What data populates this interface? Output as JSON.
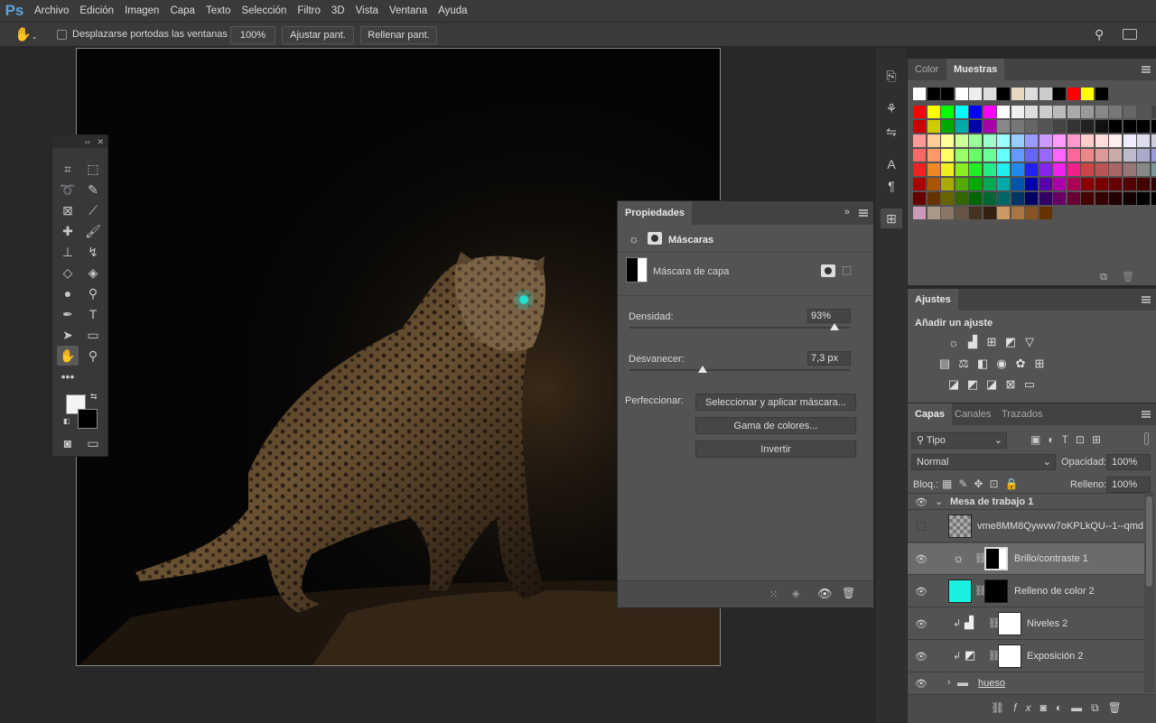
{
  "app": {
    "logo": "Ps"
  },
  "menu": [
    "Archivo",
    "Edición",
    "Imagen",
    "Capa",
    "Texto",
    "Selección",
    "Filtro",
    "3D",
    "Vista",
    "Ventana",
    "Ayuda"
  ],
  "options": {
    "scroll_all_label": "Desplazarse portodas las ventanas",
    "zoom_label": "100%",
    "fit_label": "Ajustar pant.",
    "fill_label": "Rellenar pant."
  },
  "properties": {
    "tab": "Propiedades",
    "section": "Máscaras",
    "mask_label": "Máscara de capa",
    "density_label": "Densidad:",
    "density_value": "93%",
    "density": 0.93,
    "feather_label": "Desvanecer:",
    "feather_value": "7,3 px",
    "feather": 0.33,
    "refine_label": "Perfeccionar:",
    "btn_select_mask": "Seleccionar y aplicar máscara...",
    "btn_color_range": "Gama de colores...",
    "btn_invert": "Invertir"
  },
  "swatches_panel": {
    "tab_color": "Color",
    "tab_swatches": "Muestras"
  },
  "adjustments": {
    "tab": "Ajustes",
    "heading": "Añadir un ajuste"
  },
  "layers_panel": {
    "tabs": [
      "Capas",
      "Canales",
      "Trazados"
    ],
    "filter": "Tipo",
    "blend_mode": "Normal",
    "opacity_label": "Opacidad:",
    "opacity_value": "100%",
    "lock_label": "Bloq.:",
    "fill_label": "Relleno:",
    "fill_value": "100%",
    "group_name": "Mesa de trabajo 1",
    "layers": [
      {
        "name": "vme8MM8Qywvw7oKPLkQU--1--qmd...",
        "visible": false
      },
      {
        "name": "Brillo/contraste 1",
        "visible": true
      },
      {
        "name": "Relleno de color 2",
        "visible": true
      },
      {
        "name": "Niveles 2",
        "visible": true
      },
      {
        "name": "Exposición 2",
        "visible": true
      },
      {
        "name": "hueso",
        "visible": true
      }
    ]
  },
  "colors": {
    "accent": "#5ba3e0",
    "fill_cyan": "#19f0e0"
  }
}
